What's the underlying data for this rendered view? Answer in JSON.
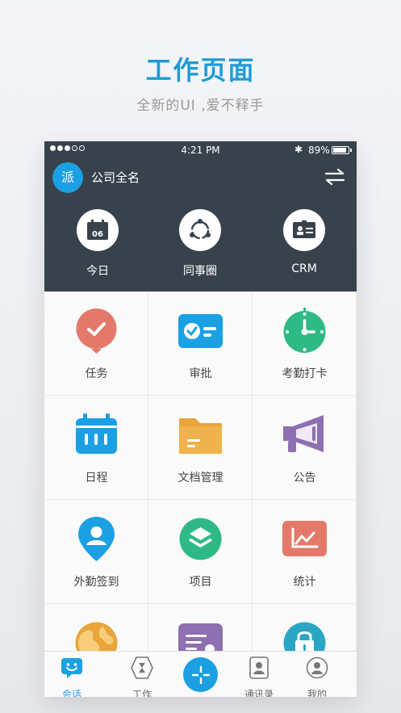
{
  "promo": {
    "title": "工作页面",
    "subtitle": "全新的UI ,爱不释手"
  },
  "status_bar": {
    "time": "4:21 PM",
    "battery": "89%",
    "battery_level": 0.89,
    "bluetooth_icon": "bluetooth-icon"
  },
  "header": {
    "logo_text": "派",
    "company_name": "公司全名",
    "switch_icon": "swap-arrows-icon"
  },
  "quick_actions": [
    {
      "label": "今日",
      "icon": "calendar-icon",
      "day": "06"
    },
    {
      "label": "同事圈",
      "icon": "circle-network-icon"
    },
    {
      "label": "CRM",
      "icon": "contact-card-icon"
    }
  ],
  "grid": [
    {
      "label": "任务",
      "icon": "task-check-icon",
      "color": "#e4796a"
    },
    {
      "label": "审批",
      "icon": "approval-icon",
      "color": "#1aa0e3"
    },
    {
      "label": "考勤打卡",
      "icon": "clock-icon",
      "color": "#2fba85"
    },
    {
      "label": "日程",
      "icon": "schedule-calendar-icon",
      "color": "#1aa0e3"
    },
    {
      "label": "文档管理",
      "icon": "folder-icon",
      "color": "#e9a43a"
    },
    {
      "label": "公告",
      "icon": "megaphone-icon",
      "color": "#8e6fb0"
    },
    {
      "label": "外勤签到",
      "icon": "location-pin-icon",
      "color": "#1aa0e3"
    },
    {
      "label": "项目",
      "icon": "layers-icon",
      "color": "#2fba85"
    },
    {
      "label": "统计",
      "icon": "chart-icon",
      "color": "#e4796a"
    },
    {
      "label": "",
      "icon": "globe-icon",
      "color": "#e9a43a"
    },
    {
      "label": "",
      "icon": "report-icon",
      "color": "#8e6fb0"
    },
    {
      "label": "",
      "icon": "lock-icon",
      "color": "#2aa6c4"
    }
  ],
  "tabbar": [
    {
      "label": "会话",
      "icon": "chat-face-icon",
      "active": true
    },
    {
      "label": "工作",
      "icon": "hourglass-icon",
      "active": false
    },
    {
      "label": "通讯录",
      "icon": "contacts-icon",
      "active": false
    },
    {
      "label": "我的",
      "icon": "profile-icon",
      "active": false
    }
  ]
}
